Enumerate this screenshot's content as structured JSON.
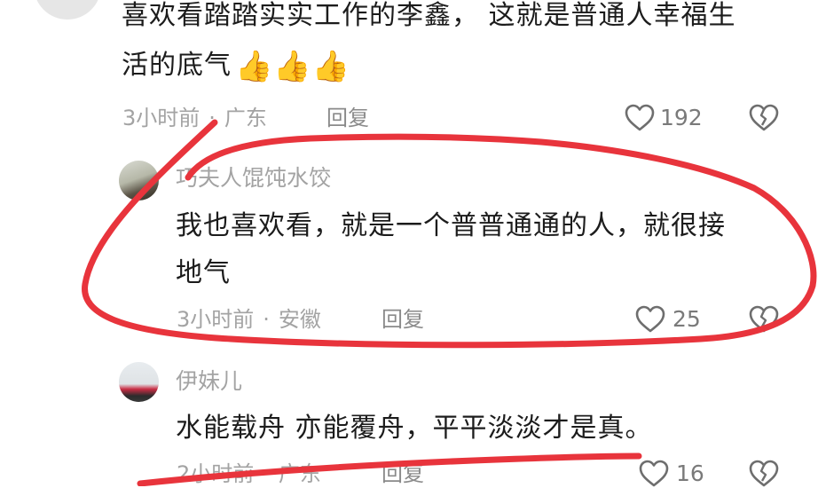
{
  "comment1": {
    "text_line1": "喜欢看踏踏实实工作的李鑫， 这就是普通人幸福生",
    "text_line2": "活的底气",
    "emoji": "👍👍👍",
    "time": "3小时前",
    "location": "广东",
    "reply_label": "回复",
    "likes": "192"
  },
  "reply1": {
    "username": "巧夫人馄饨水饺",
    "text_line1": "我也喜欢看，就是一个普普通通的人，就很接",
    "text_line2": "地气",
    "time": "3小时前",
    "location": "安徽",
    "reply_label": "回复",
    "likes": "25"
  },
  "reply2": {
    "username": "伊妹儿",
    "text": "水能载舟 亦能覆舟，平平淡淡才是真。",
    "time": "2小时前",
    "location": "广东",
    "reply_label": "回复",
    "likes": "16"
  },
  "colors": {
    "annotation_red": "#e8343c",
    "text_primary": "#1c1c1c",
    "text_secondary": "#a3a3a3"
  },
  "icons": [
    "heart-icon",
    "broken-heart-icon",
    "thumbs-up-emoji"
  ]
}
